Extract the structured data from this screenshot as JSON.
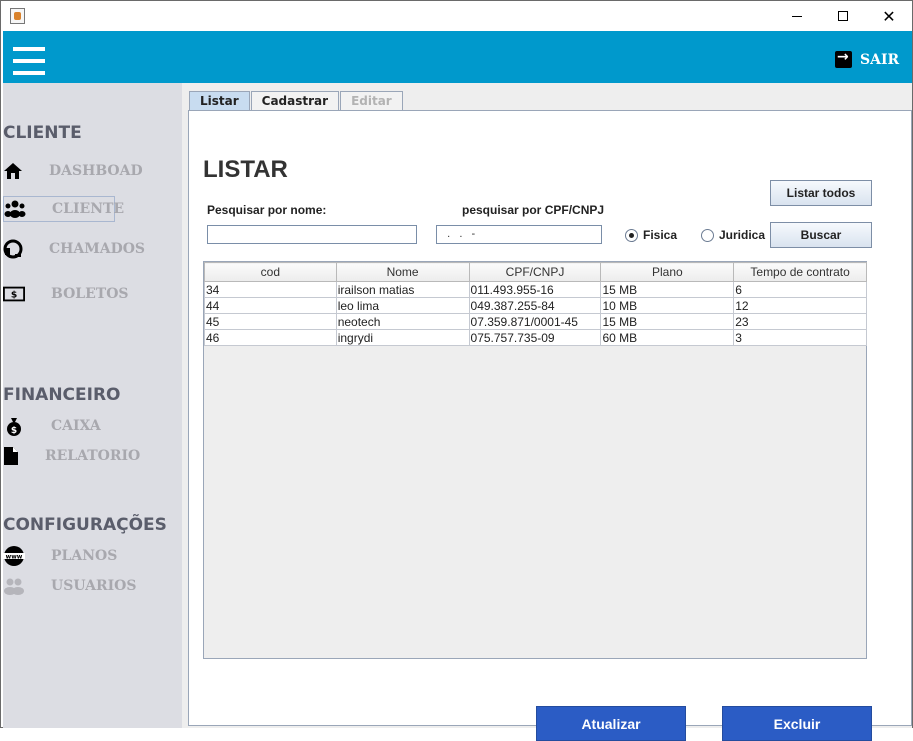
{
  "window": {
    "close_label": "✕"
  },
  "header": {
    "sair_label": "SAIR"
  },
  "sidebar": {
    "sections": [
      {
        "title": "CLIENTE",
        "items": [
          {
            "label": "DASHBOAD",
            "icon": "home-icon"
          },
          {
            "label": "CLIENTE",
            "icon": "users-icon"
          },
          {
            "label": "CHAMADOS",
            "icon": "headset-icon"
          },
          {
            "label": "BOLETOS",
            "icon": "money-icon"
          }
        ]
      },
      {
        "title": "FINANCEIRO",
        "items": [
          {
            "label": "CAIXA",
            "icon": "money-bag-icon"
          },
          {
            "label": "RELATORIO",
            "icon": "file-icon"
          }
        ]
      },
      {
        "title": "CONFIGURAÇÕES",
        "items": [
          {
            "label": "PLANOS",
            "icon": "globe-icon"
          },
          {
            "label": "USUARIOS",
            "icon": "group-icon"
          }
        ]
      }
    ],
    "active_item": "CLIENTE"
  },
  "tabs": [
    {
      "label": "Listar",
      "state": "active"
    },
    {
      "label": "Cadastrar",
      "state": "normal"
    },
    {
      "label": "Editar",
      "state": "disabled"
    }
  ],
  "listar": {
    "title": "LISTAR",
    "search_name_label": "Pesquisar por nome:",
    "search_name_value": "",
    "search_doc_label": "pesquisar por CPF/CNPJ",
    "search_doc_value": "  .   .   -",
    "radio_fisica": "Fisica",
    "radio_juridica": "Juridica",
    "radio_selected": "Fisica",
    "btn_listar_todos": "Listar todos",
    "btn_buscar": "Buscar",
    "btn_atualizar": "Atualizar",
    "btn_excluir": "Excluir"
  },
  "table": {
    "columns": [
      "cod",
      "Nome",
      "CPF/CNPJ",
      "Plano",
      "Tempo de contrato"
    ],
    "rows": [
      [
        "34",
        "irailson matias",
        "011.493.955-16",
        "15 MB",
        "6"
      ],
      [
        "44",
        "leo lima",
        "049.387.255-84",
        "10 MB",
        "12"
      ],
      [
        "45",
        "neotech",
        "07.359.871/0001-45",
        "15 MB",
        "23"
      ],
      [
        "46",
        "ingrydi",
        "075.757.735-09",
        "60 MB",
        "3"
      ]
    ]
  },
  "colors": {
    "header_bg": "#0099cc",
    "sidebar_bg": "#dcdde3",
    "button_blue": "#2b5cc5"
  }
}
